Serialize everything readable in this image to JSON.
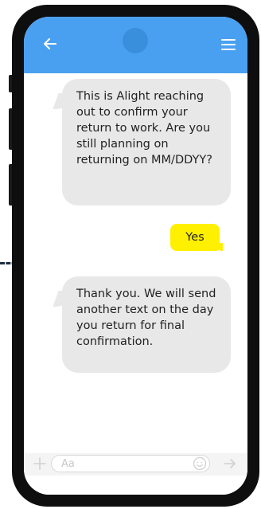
{
  "app": {
    "colors": {
      "header": "#4aa0f0",
      "incoming_bubble": "#e8e8e8",
      "outgoing_bubble": "#fff000",
      "phone_frame": "#0e0e0e"
    },
    "header_icons": {
      "left": "back-arrow-icon",
      "right": "hamburger-menu-icon"
    }
  },
  "messages": [
    {
      "direction": "incoming",
      "text": "This is Alight reaching out to confirm your return to work. Are you still planning on returning on MM/DDYY?"
    },
    {
      "direction": "outgoing",
      "text": "Yes"
    },
    {
      "direction": "incoming",
      "text": "Thank you. We will send another text on the day you return for final confirmation."
    }
  ],
  "composer": {
    "placeholder": "Aa",
    "icons": [
      "plus-icon",
      "emoji-icon",
      "send-arrow-icon"
    ]
  }
}
